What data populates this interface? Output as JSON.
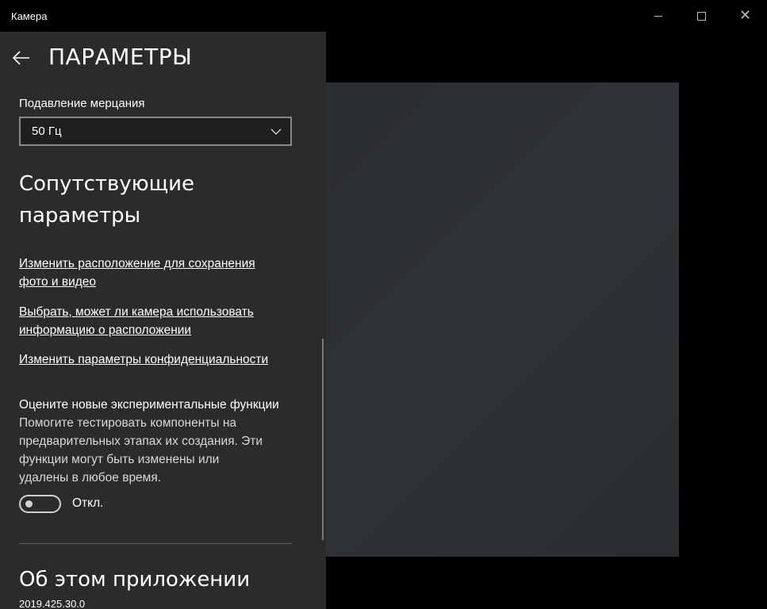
{
  "window": {
    "title": "Камера",
    "minimize_icon": "minimize-icon",
    "maximize_icon": "maximize-icon",
    "close_icon": "close-icon"
  },
  "settings": {
    "header": {
      "back_icon": "back-arrow-icon",
      "title": "ПАРАМЕТРЫ"
    },
    "flicker": {
      "label": "Подавление мерцания",
      "selected": "50 Гц",
      "chevron_icon": "chevron-down-icon"
    },
    "related": {
      "title_line1": "Сопутствующие",
      "title_line2": "параметры",
      "links": [
        {
          "line1": "Изменить расположение для сохранения",
          "line2": "фото и видео"
        },
        {
          "line1": "Выбрать, может ли камера использовать",
          "line2": "информацию о расположении"
        },
        {
          "line1": "Изменить параметры конфиденциальности"
        }
      ]
    },
    "experimental": {
      "title": "Оцените новые экспериментальные функции",
      "description_lines": [
        "Помогите тестировать компоненты на",
        "предварительных этапах их создания. Эти",
        "функции могут быть изменены или",
        "удалены в любое время."
      ],
      "toggle_state": "Откл.",
      "toggle_on": false
    },
    "about": {
      "title": "Об этом приложении",
      "version": "2019.425.30.0"
    }
  },
  "colors": {
    "panel_bg": "#2b2b2b",
    "window_bg": "#000000",
    "preview_bg": "#2d3034"
  }
}
